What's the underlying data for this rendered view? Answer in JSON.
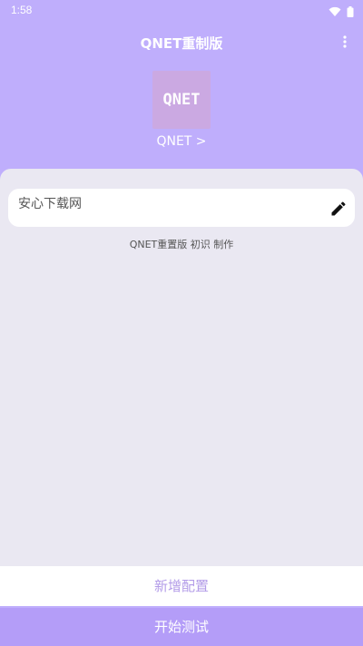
{
  "status_bar": {
    "time": "1:58",
    "icons": [
      "wifi-icon",
      "battery-icon"
    ]
  },
  "app_bar": {
    "title": "QNET重制版",
    "menu_icon": "more-vert-icon"
  },
  "logo": {
    "text": "QNET",
    "link_text": "QNET >"
  },
  "config_list": [
    {
      "name": "安心下载网",
      "action_icon": "edit-pencil-icon"
    }
  ],
  "credit": "QNET重置版 初识 制作",
  "buttons": {
    "add_config": "新增配置",
    "start_test": "开始测试"
  },
  "colors": {
    "primary": "#bfaefc",
    "logo_bg": "#cba9e2",
    "panel_bg": "#eae8f2",
    "add_config_text": "#b39ce8",
    "start_bg": "#b49df8"
  }
}
